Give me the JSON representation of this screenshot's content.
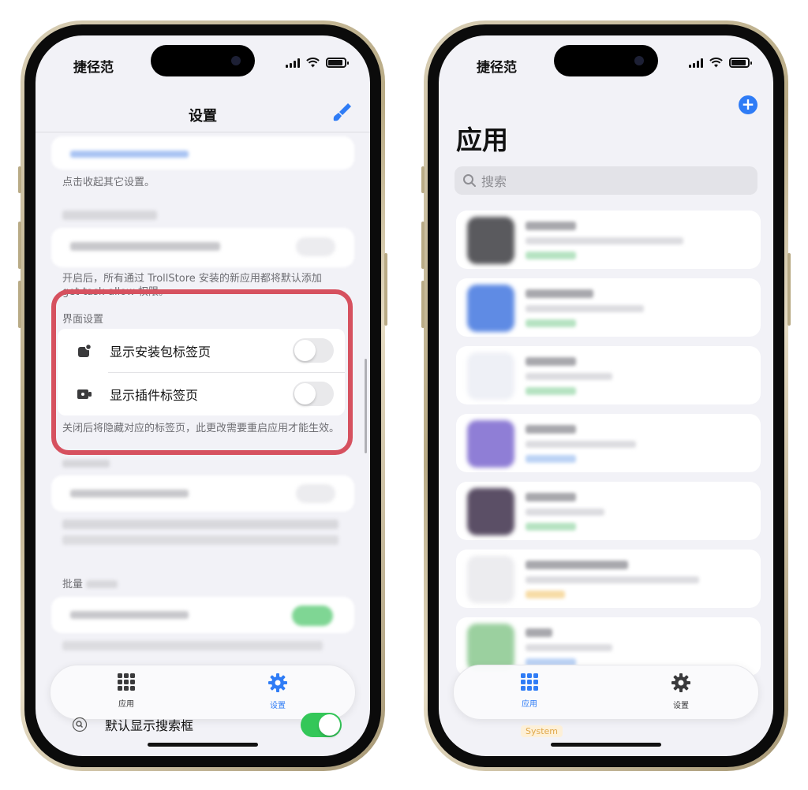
{
  "status_bar": {
    "carrier": "捷径范"
  },
  "left": {
    "nav_title": "设置",
    "footnote_collapse": "点击收起其它设置。",
    "footnote_trollstore": "开启后，所有通过 TrollStore 安装的新应用都将默认添加 get-task-allow 权限。",
    "section_label": "界面设置",
    "rows": [
      {
        "label": "显示安装包标签页",
        "icon": "package-icon",
        "enabled": false
      },
      {
        "label": "显示插件标签页",
        "icon": "plugin-icon",
        "enabled": false
      }
    ],
    "section_footer": "关闭后将隐藏对应的标签页，此更改需要重启应用才能生效。",
    "batch_section_label_partial": "批量",
    "bottom_row": {
      "label": "默认显示搜索框",
      "icon": "search-icon",
      "enabled": true
    },
    "tabbar": {
      "tabs": [
        {
          "label": "应用",
          "icon": "grid-icon",
          "active": false
        },
        {
          "label": "设置",
          "icon": "gear-icon",
          "active": true
        }
      ]
    }
  },
  "right": {
    "large_title": "应用",
    "search_placeholder": "搜索",
    "system_badge": "System",
    "tabbar": {
      "tabs": [
        {
          "label": "应用",
          "icon": "grid-icon",
          "active": true
        },
        {
          "label": "设置",
          "icon": "gear-icon",
          "active": false
        }
      ]
    }
  },
  "colors": {
    "accent": "#2f7cf6",
    "highlight": "#d6515f",
    "switch_on": "#34c759",
    "badge": "#e0a84a"
  }
}
